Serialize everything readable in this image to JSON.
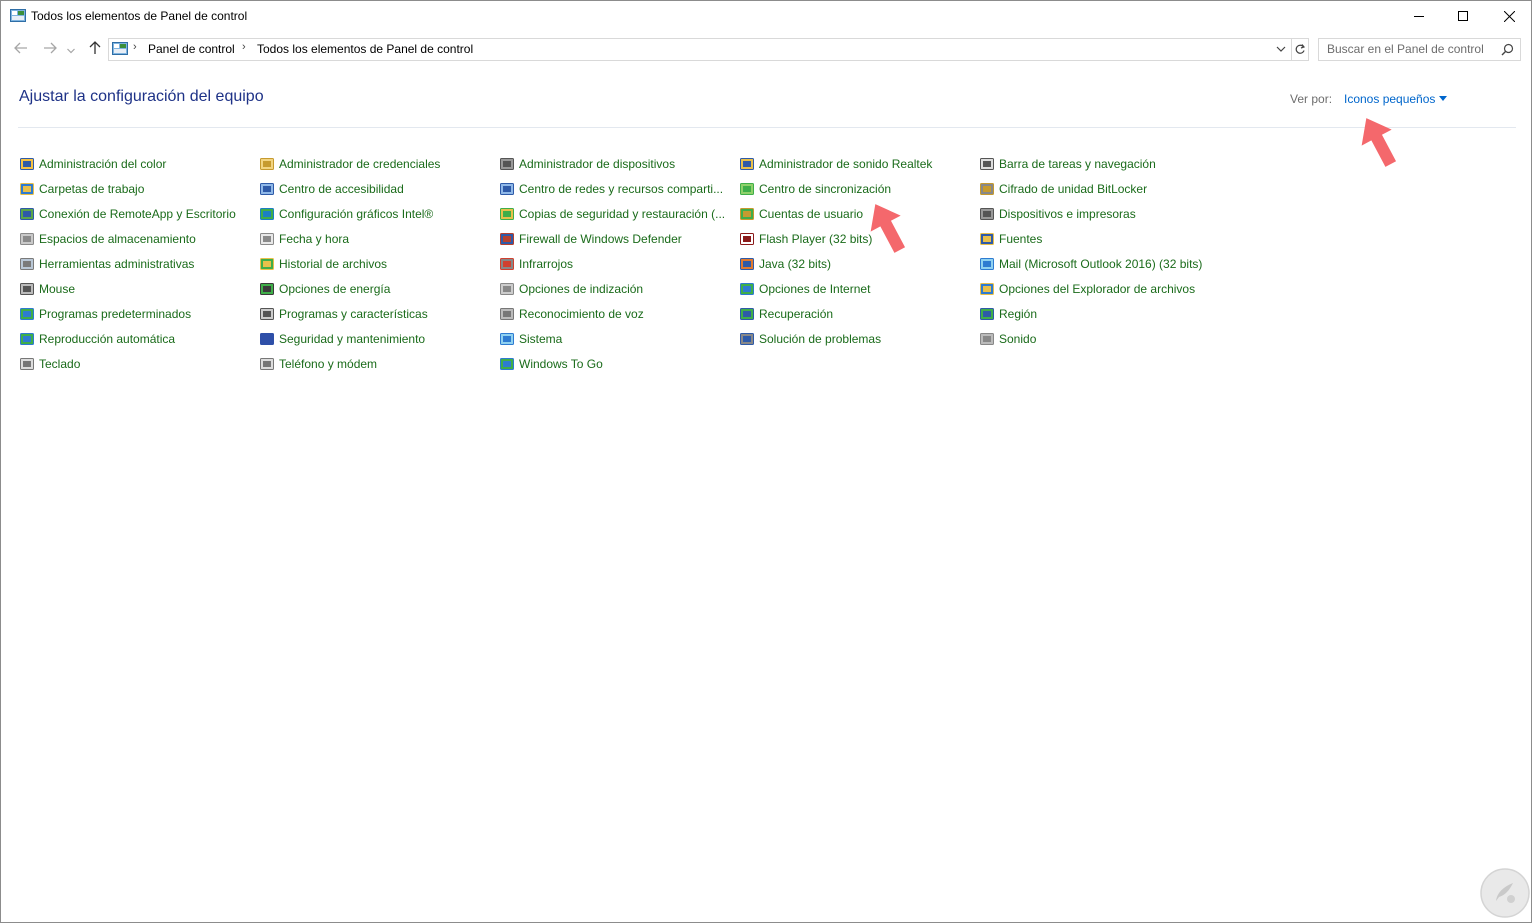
{
  "window": {
    "title": "Todos los elementos de Panel de control"
  },
  "nav": {
    "breadcrumb": [
      "Panel de control",
      "Todos los elementos de Panel de control"
    ]
  },
  "search": {
    "placeholder": "Buscar en el Panel de control"
  },
  "header": {
    "title": "Ajustar la configuración del equipo",
    "view_by_label": "Ver por:",
    "view_by_value": "Iconos pequeños"
  },
  "columns": [
    {
      "items": [
        {
          "label": "Administración del color",
          "icon": "color-management-icon"
        },
        {
          "label": "Carpetas de trabajo",
          "icon": "work-folders-icon"
        },
        {
          "label": "Conexión de RemoteApp y Escritorio",
          "icon": "remoteapp-icon"
        },
        {
          "label": "Espacios de almacenamiento",
          "icon": "storage-spaces-icon"
        },
        {
          "label": "Herramientas administrativas",
          "icon": "admin-tools-icon"
        },
        {
          "label": "Mouse",
          "icon": "mouse-icon"
        },
        {
          "label": "Programas predeterminados",
          "icon": "default-programs-icon"
        },
        {
          "label": "Reproducción automática",
          "icon": "autoplay-icon"
        },
        {
          "label": "Teclado",
          "icon": "keyboard-icon"
        }
      ]
    },
    {
      "items": [
        {
          "label": "Administrador de credenciales",
          "icon": "credential-manager-icon"
        },
        {
          "label": "Centro de accesibilidad",
          "icon": "accessibility-icon"
        },
        {
          "label": "Configuración gráficos Intel®",
          "icon": "intel-graphics-icon"
        },
        {
          "label": "Fecha y hora",
          "icon": "date-time-icon"
        },
        {
          "label": "Historial de archivos",
          "icon": "file-history-icon"
        },
        {
          "label": "Opciones de energía",
          "icon": "power-options-icon"
        },
        {
          "label": "Programas y características",
          "icon": "programs-features-icon"
        },
        {
          "label": "Seguridad y mantenimiento",
          "icon": "security-flag-icon"
        },
        {
          "label": "Teléfono y módem",
          "icon": "phone-modem-icon"
        }
      ]
    },
    {
      "items": [
        {
          "label": "Administrador de dispositivos",
          "icon": "device-manager-icon"
        },
        {
          "label": "Centro de redes y recursos comparti...",
          "icon": "network-center-icon"
        },
        {
          "label": "Copias de seguridad y restauración (...",
          "icon": "backup-restore-icon"
        },
        {
          "label": "Firewall de Windows Defender",
          "icon": "firewall-icon"
        },
        {
          "label": "Infrarrojos",
          "icon": "infrared-icon"
        },
        {
          "label": "Opciones de indización",
          "icon": "indexing-icon"
        },
        {
          "label": "Reconocimiento de voz",
          "icon": "speech-microphone-icon"
        },
        {
          "label": "Sistema",
          "icon": "system-icon"
        },
        {
          "label": "Windows To Go",
          "icon": "windows-to-go-icon"
        }
      ]
    },
    {
      "items": [
        {
          "label": "Administrador de sonido Realtek",
          "icon": "realtek-audio-icon"
        },
        {
          "label": "Centro de sincronización",
          "icon": "sync-center-icon"
        },
        {
          "label": "Cuentas de usuario",
          "icon": "user-accounts-icon"
        },
        {
          "label": "Flash Player (32 bits)",
          "icon": "flash-player-icon"
        },
        {
          "label": "Java (32 bits)",
          "icon": "java-icon"
        },
        {
          "label": "Opciones de Internet",
          "icon": "internet-options-icon"
        },
        {
          "label": "Recuperación",
          "icon": "recovery-icon"
        },
        {
          "label": "Solución de problemas",
          "icon": "troubleshooting-icon"
        }
      ]
    },
    {
      "items": [
        {
          "label": "Barra de tareas y navegación",
          "icon": "taskbar-icon"
        },
        {
          "label": "Cifrado de unidad BitLocker",
          "icon": "bitlocker-icon"
        },
        {
          "label": "Dispositivos e impresoras",
          "icon": "devices-printers-icon"
        },
        {
          "label": "Fuentes",
          "icon": "fonts-icon"
        },
        {
          "label": "Mail (Microsoft Outlook 2016) (32 bits)",
          "icon": "mail-icon"
        },
        {
          "label": "Opciones del Explorador de archivos",
          "icon": "explorer-options-icon"
        },
        {
          "label": "Región",
          "icon": "region-icon"
        },
        {
          "label": "Sonido",
          "icon": "sound-icon"
        }
      ]
    }
  ],
  "colors": {
    "link_green": "#1a6b1a",
    "title_blue": "#1e3287",
    "link_blue": "#0066cc",
    "annotation_arrow": "#f4686c"
  }
}
